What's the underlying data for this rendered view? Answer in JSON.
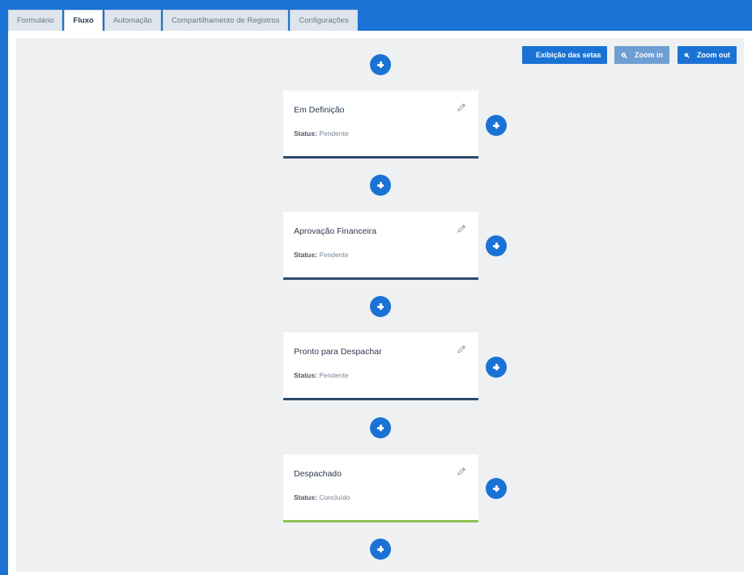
{
  "tabs": [
    {
      "label": "Formulário",
      "active": false
    },
    {
      "label": "Fluxo",
      "active": true
    },
    {
      "label": "Automação",
      "active": false
    },
    {
      "label": "Compartilhamento de Registros",
      "active": false
    },
    {
      "label": "Configurações",
      "active": false
    }
  ],
  "toolbar": {
    "arrows_label": "Exibição das setas",
    "zoom_in_label": "Zoom in",
    "zoom_out_label": "Zoom out"
  },
  "status_label": "Status:",
  "stages": [
    {
      "title": "Em Definição",
      "status": "Pendente"
    },
    {
      "title": "Aprovação Financeira",
      "status": "Pendente"
    },
    {
      "title": "Pronto para Despachar",
      "status": "Pendente"
    },
    {
      "title": "Despachado",
      "status": "Concluído"
    }
  ],
  "colors": {
    "primary": "#1a73d4",
    "pending_bar": "#2b4a6b",
    "done_bar": "#8cc152"
  }
}
